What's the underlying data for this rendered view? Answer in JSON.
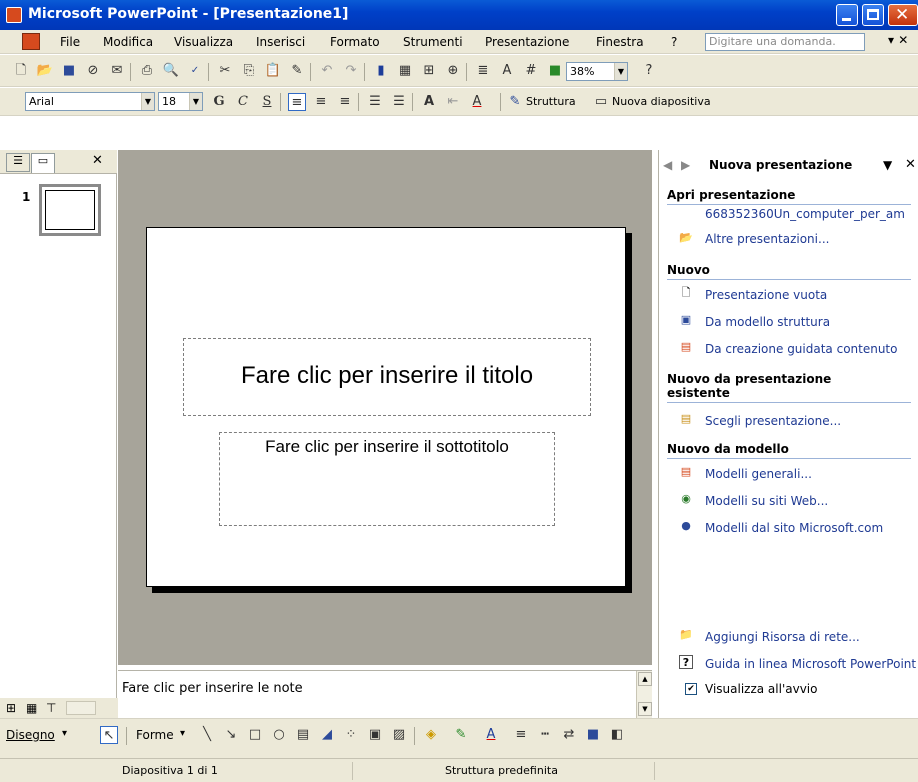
{
  "window": {
    "title": "Microsoft PowerPoint - [Presentazione1]"
  },
  "menu": {
    "items": [
      "File",
      "Modifica",
      "Visualizza",
      "Inserisci",
      "Formato",
      "Strumenti",
      "Presentazione",
      "Finestra",
      "?"
    ],
    "ask_placeholder": "Digitare una domanda."
  },
  "toolbar_standard": {
    "zoom": "38%"
  },
  "toolbar_format": {
    "font": "Arial",
    "size": "18",
    "bold": "G",
    "italic": "C",
    "shadow": "S",
    "design_label": "Struttura",
    "new_slide_label": "Nuova diapositiva"
  },
  "outline": {
    "slide_number": "1"
  },
  "slide": {
    "title_placeholder": "Fare clic per inserire il titolo",
    "subtitle_placeholder": "Fare clic per inserire il sottotitolo"
  },
  "notes": {
    "placeholder": "Fare clic per inserire le note"
  },
  "taskpane": {
    "title": "Nuova presentazione",
    "open_heading": "Apri presentazione",
    "recent_file": "668352360Un_computer_per_am",
    "more_presentations": "Altre presentazioni...",
    "new_heading": "Nuovo",
    "blank": "Presentazione vuota",
    "from_design": "Da modello struttura",
    "autocontent": "Da creazione guidata contenuto",
    "from_existing_heading_1": "Nuovo da presentazione",
    "from_existing_heading_2": "esistente",
    "choose_presentation": "Scegli presentazione...",
    "from_template_heading": "Nuovo da modello",
    "general_templates": "Modelli generali...",
    "web_templates": "Modelli su siti Web...",
    "ms_templates": "Modelli dal sito Microsoft.com",
    "add_network": "Aggiungi Risorsa di rete...",
    "help": "Guida in linea Microsoft PowerPoint",
    "show_at_startup": "Visualizza all'avvio"
  },
  "drawing": {
    "draw_label": "Disegno",
    "shapes_label": "Forme"
  },
  "status": {
    "slide": "Diapositiva 1 di 1",
    "design": "Struttura predefinita"
  },
  "colors": {
    "titlebar": "#0040c8",
    "chrome": "#ece9d8",
    "slide_bg": "#a7a49a",
    "link": "#1f3a93"
  }
}
